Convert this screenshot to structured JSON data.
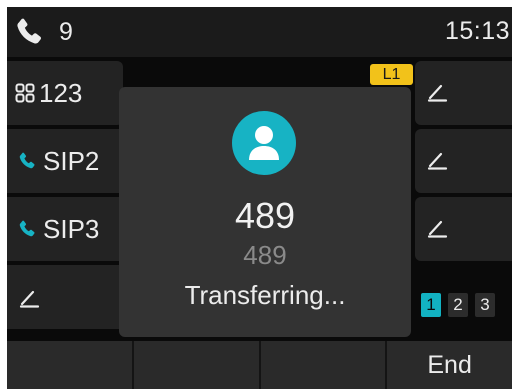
{
  "status": {
    "line_count": "9",
    "time": "15:13"
  },
  "left_keys": [
    {
      "label": "123",
      "icon": "grid-icon"
    },
    {
      "label": "SIP2",
      "icon": "phone-icon"
    },
    {
      "label": "SIP3",
      "icon": "phone-icon"
    },
    {
      "label": "",
      "icon": "edit-icon"
    }
  ],
  "right_keys": [
    {
      "icon": "edit-icon"
    },
    {
      "icon": "edit-icon"
    },
    {
      "icon": "edit-icon"
    }
  ],
  "line_badge": "L1",
  "call": {
    "number": "489",
    "subnumber": "489",
    "status": "Transferring..."
  },
  "pages": [
    "1",
    "2",
    "3"
  ],
  "active_page": "1",
  "softkeys": [
    "",
    "",
    "",
    "End"
  ],
  "colors": {
    "accent": "#12b2c2",
    "badge": "#f2c21a",
    "background": "#0a0a0a"
  }
}
